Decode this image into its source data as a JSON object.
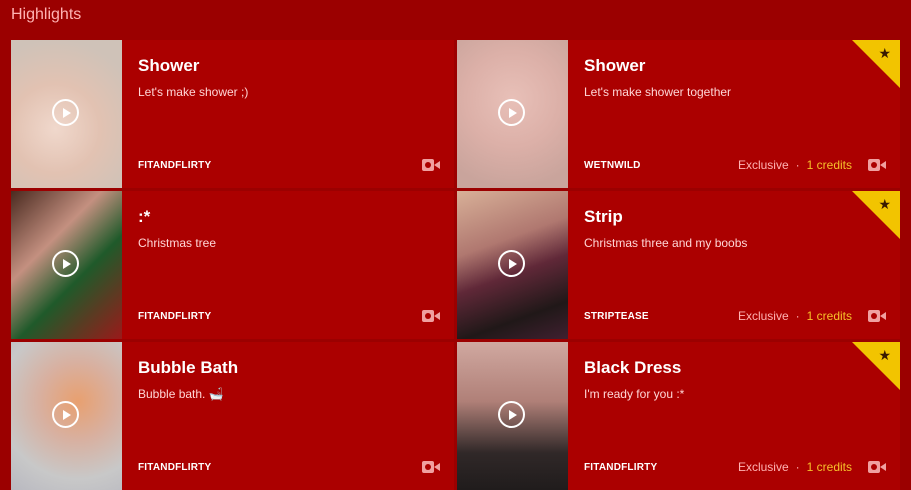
{
  "header": {
    "title": "Highlights"
  },
  "cards": [
    {
      "title": "Shower",
      "description": "Let's make shower ;)",
      "author": "FITANDFLIRTY",
      "exclusive": "",
      "credits": ""
    },
    {
      "title": "Shower",
      "description": "Let's make shower together",
      "author": "WETNWILD",
      "exclusive": "Exclusive",
      "credits": "1 credits"
    },
    {
      "title": ":*",
      "description": "Christmas tree",
      "author": "FITANDFLIRTY",
      "exclusive": "",
      "credits": ""
    },
    {
      "title": "Strip",
      "description": "Christmas three and my boobs",
      "author": "STRIPTEASE",
      "exclusive": "Exclusive",
      "credits": "1 credits"
    },
    {
      "title": "Bubble Bath",
      "description": "Bubble bath. 🛁",
      "author": "FITANDFLIRTY",
      "exclusive": "",
      "credits": ""
    },
    {
      "title": "Black Dress",
      "description": "I'm ready for you :*",
      "author": "FITANDFLIRTY",
      "exclusive": "Exclusive",
      "credits": "1 credits"
    }
  ],
  "meta_separator": "·",
  "icons": {
    "play": "play-icon",
    "camera": "video-camera-icon",
    "star": "star-icon"
  },
  "colors": {
    "background": "#9b0000",
    "card": "#ab0000",
    "credits": "#f6c12a",
    "ribbon": "#f2c400"
  }
}
